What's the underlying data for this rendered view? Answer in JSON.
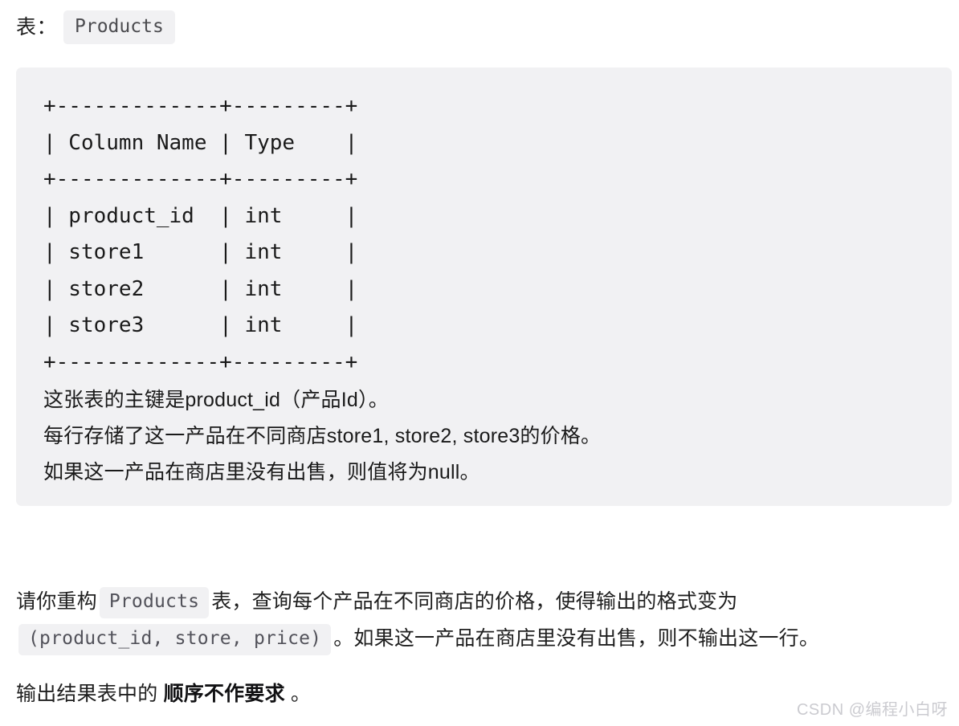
{
  "header": {
    "label": "表：",
    "table_name": "Products"
  },
  "code_block": {
    "ascii_table": "+-------------+---------+\n| Column Name | Type    |\n+-------------+---------+\n| product_id  | int     |\n| store1      | int     |\n| store2      | int     |\n| store3      | int     |\n+-------------+---------+",
    "schema": {
      "columns": [
        "Column Name",
        "Type"
      ],
      "rows": [
        [
          "product_id",
          "int"
        ],
        [
          "store1",
          "int"
        ],
        [
          "store2",
          "int"
        ],
        [
          "store3",
          "int"
        ]
      ]
    },
    "description_lines": [
      "这张表的主键是product_id（产品Id）。",
      "每行存储了这一产品在不同商店store1, store2, store3的价格。",
      "如果这一产品在商店里没有出售，则值将为null。"
    ]
  },
  "body": {
    "reconstruct": {
      "prefix": "请你重构",
      "chip_table": "Products",
      "middle": "表，查询每个产品在不同商店的价格，使得输出的格式变为",
      "chip_format": "(product_id, store, price)",
      "suffix": "。如果这一产品在商店里没有出售，则不输出这一行。"
    },
    "order": {
      "prefix": "输出结果表中的",
      "bold": "顺序不作要求",
      "suffix": "。"
    }
  },
  "watermark": {
    "text": "CSDN @编程小白呀"
  }
}
